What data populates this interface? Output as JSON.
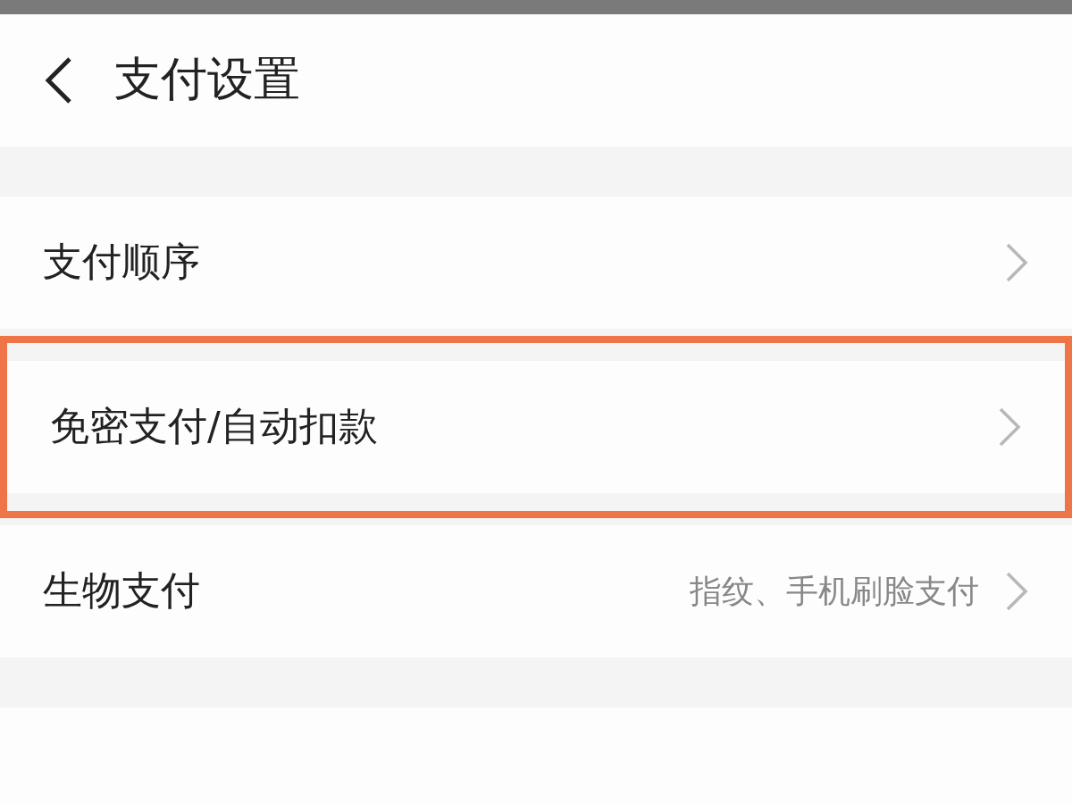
{
  "header": {
    "title": "支付设置"
  },
  "items": [
    {
      "label": "支付顺序",
      "highlighted": false
    },
    {
      "label": "免密支付/自动扣款",
      "highlighted": true
    },
    {
      "label": "生物支付",
      "value": "指纹、手机刷脸支付",
      "highlighted": false
    }
  ]
}
